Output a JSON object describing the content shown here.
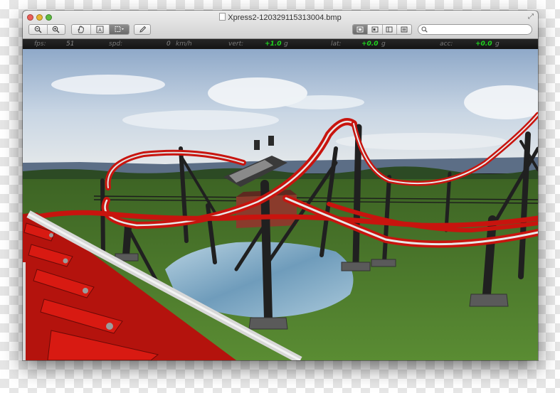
{
  "window": {
    "title": "Xpress2-120329115313004.bmp"
  },
  "toolbar": {
    "zoom_out_icon": "zoom-out-icon",
    "zoom_in_icon": "zoom-in-icon",
    "hand_icon": "hand-tool-icon",
    "text_select_icon": "text-select-icon",
    "rect_select_icon": "rectangle-select-icon",
    "annotate_icon": "pencil-icon",
    "view_modes": [
      "single-view-icon",
      "two-page-icon",
      "sidebar-view-icon",
      "contact-sheet-icon"
    ],
    "search_placeholder": ""
  },
  "hud": {
    "fps_label": "fps:",
    "fps_value": "51",
    "spd_label": "spd:",
    "spd_value": "0",
    "spd_unit": "km/h",
    "vert_label": "vert:",
    "vert_value": "+1.0",
    "vert_unit": "g",
    "lat_label": "lat:",
    "lat_value": "+0.0",
    "lat_unit": "g",
    "acc_label": "acc:",
    "acc_value": "+0.0",
    "acc_unit": "g"
  },
  "colors": {
    "track_red": "#c8140e",
    "rail_white": "#e8e8e8",
    "support_dark": "#262626",
    "grass": "#4a7a2c",
    "sky_top": "#8fa9c9",
    "hud_green": "#1fd61f"
  }
}
